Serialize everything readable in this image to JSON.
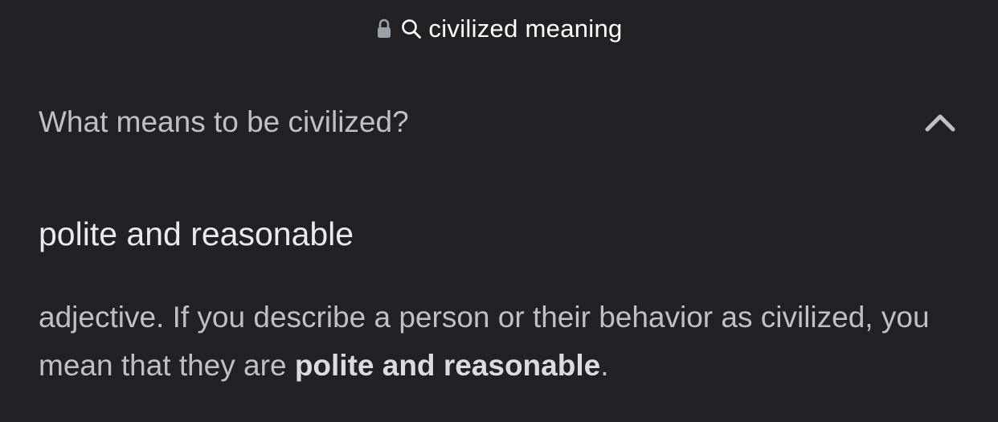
{
  "url_bar": {
    "query": "civilized meaning",
    "lock_icon": "lock-icon",
    "search_icon": "search-icon"
  },
  "question": {
    "text": "What means to be civilized?",
    "toggle_icon": "chevron-up-icon"
  },
  "answer": {
    "title": "polite and reasonable",
    "description_prefix": "adjective. If you describe a person or their behavior as civilized, you mean that they are ",
    "description_bold": "polite and reasonable",
    "description_suffix": "."
  },
  "colors": {
    "background": "#202124",
    "text_primary": "#e8eaed",
    "text_secondary": "#bdc1c6"
  }
}
